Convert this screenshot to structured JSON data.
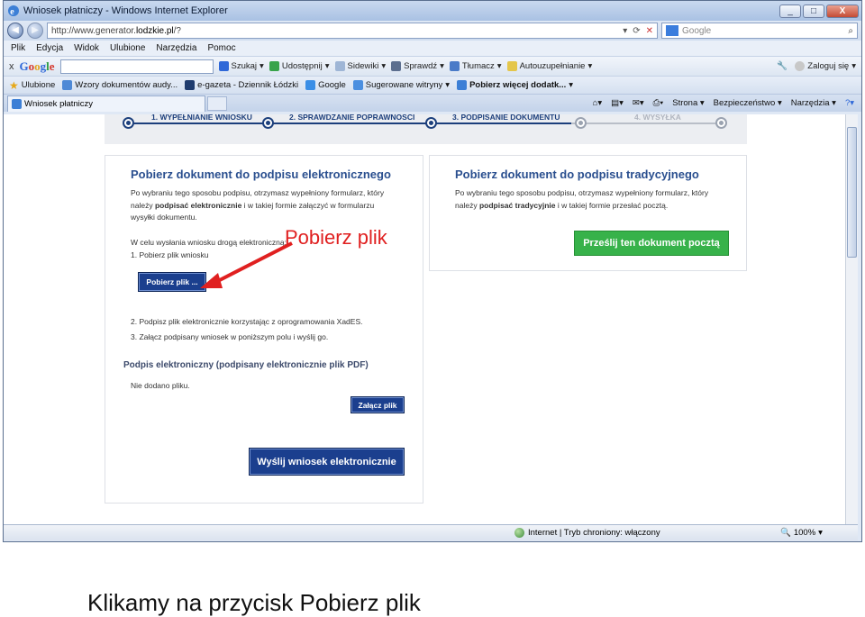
{
  "window": {
    "title": "Wniosek płatniczy - Windows Internet Explorer",
    "buttons": [
      "_",
      "□",
      "X"
    ]
  },
  "address": {
    "prefix": "http://www.generator.",
    "domain": "lodzkie.pl",
    "suffix": "/?",
    "search_placeholder": "Google"
  },
  "menu": [
    "Plik",
    "Edycja",
    "Widok",
    "Ulubione",
    "Narzędzia",
    "Pomoc"
  ],
  "google_toolbar": {
    "close": "x",
    "logo": {
      "g": "G",
      "o1": "o",
      "o2": "o",
      "g2": "g",
      "l": "l",
      "e": "e"
    },
    "items": [
      "Szukaj",
      "Udostępnij",
      "Sidewiki",
      "Sprawdź",
      "Tłumacz",
      "Autouzupełnianie"
    ],
    "right": [
      "Zaloguj się"
    ]
  },
  "favorites": {
    "label": "Ulubione",
    "items": [
      "Wzory dokumentów audy...",
      "e-gazeta - Dziennik Łódzki",
      "Google",
      "Sugerowane witryny",
      "Pobierz więcej dodatk..."
    ]
  },
  "tab": {
    "label": "Wniosek płatniczy"
  },
  "commandbar": [
    "Strona",
    "Bezpieczeństwo",
    "Narzędzia"
  ],
  "steps": [
    "1. WYPEŁNIANIE WNIOSKU",
    "2. SPRAWDZANIE POPRAWNOŚCI",
    "3. PODPISANIE DOKUMENTU",
    "4. WYSYŁKA"
  ],
  "left_panel": {
    "title": "Pobierz dokument do podpisu elektronicznego",
    "intro_1": "Po wybraniu tego sposobu podpisu, otrzymasz wypełniony formularz, który",
    "intro_2_a": "należy ",
    "intro_2_b": "podpisać elektronicznie",
    "intro_2_c": " i w takiej formie załączyć w formularzu",
    "intro_3": "wysyłki dokumentu.",
    "note": "W celu wysłania wniosku drogą elektroniczną:",
    "step1": "1.   Pobierz plik wniosku",
    "download_btn": "Pobierz plik ...",
    "step2": "2.   Podpisz plik elektronicznie korzystając z oprogramowania XadES.",
    "step3": "3.   Załącz podpisany wniosek w poniższym polu i wyślij go.",
    "signature_heading": "Podpis elektroniczny (podpisany elektronicznie plik PDF)",
    "no_file": "Nie dodano pliku.",
    "attach_btn": "Załącz plik",
    "send_btn": "Wyślij wniosek elektronicznie"
  },
  "right_panel": {
    "title": "Pobierz dokument do podpisu tradycyjnego",
    "intro_1": "Po wybraniu tego sposobu podpisu, otrzymasz wypełniony formularz, który",
    "intro_2_a": "należy ",
    "intro_2_b": "podpisać tradycyjnie",
    "intro_2_c": " i w takiej formie przesłać pocztą.",
    "send_post_btn": "Prześlij ten dokument pocztą"
  },
  "annotation": {
    "label": "Pobierz plik",
    "color": "#e02020"
  },
  "status": {
    "zone": "Internet | Tryb chroniony: włączony",
    "zoom": "100%"
  },
  "caption": "Klikamy na przycisk Pobierz plik"
}
